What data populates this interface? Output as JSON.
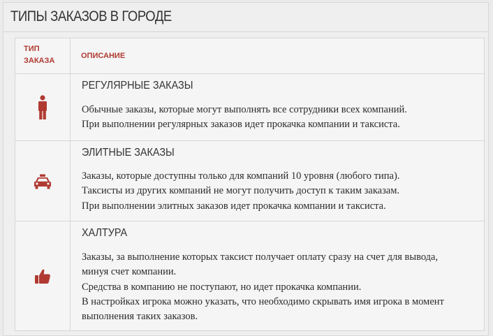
{
  "panel": {
    "title": "ТИПЫ ЗАКАЗОВ В ГОРОДЕ"
  },
  "table": {
    "headers": {
      "type": "ТИП ЗАКАЗА",
      "description": "ОПИСАНИЕ"
    },
    "accent_color": "#b03a32",
    "rows": [
      {
        "icon": "person-icon",
        "title": "РЕГУЛЯРНЫЕ ЗАКАЗЫ",
        "lines": [
          "Обычные заказы, которые могут выполнять все сотрудники всех компаний.",
          "При выполнении регулярных заказов идет прокачка компании и таксиста."
        ]
      },
      {
        "icon": "taxi-icon",
        "title": "ЭЛИТНЫЕ ЗАКАЗЫ",
        "lines": [
          "Заказы, которые доступны только для компаний 10 уровня (любого типа).",
          "Таксисты из других компаний не могут получить доступ к таким заказам.",
          "При выполнении элитных заказов идет прокачка компании и таксиста."
        ]
      },
      {
        "icon": "thumbs-up-icon",
        "title": "ХАЛТУРА",
        "lines": [
          "Заказы, за выполнение которых таксист получает оплату сразу на счет для вывода,",
          "минуя счет компании.",
          "Средства в компанию не поступают, но идет прокачка компании.",
          "В настройках игрока можно указать, что необходимо скрывать имя игрока в момент",
          "выполнения таких заказов."
        ]
      }
    ]
  }
}
